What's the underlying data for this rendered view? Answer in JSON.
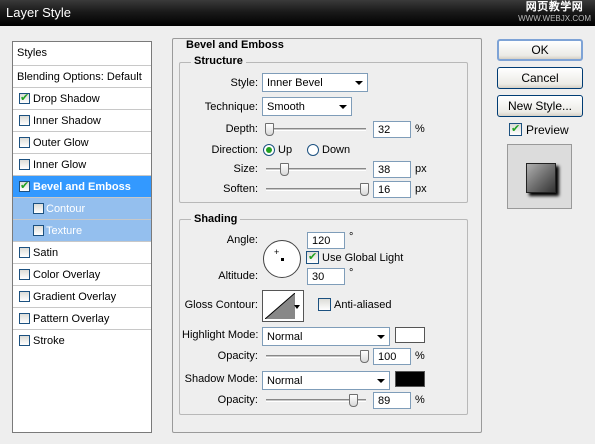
{
  "window": {
    "title": "Layer Style",
    "watermark_line1": "网页教学网",
    "watermark_line2": "WWW.WEBJX.COM"
  },
  "styles_list": {
    "header": "Styles",
    "blending": "Blending Options: Default",
    "items": [
      {
        "label": "Drop Shadow",
        "checked": true
      },
      {
        "label": "Inner Shadow",
        "checked": false
      },
      {
        "label": "Outer Glow",
        "checked": false
      },
      {
        "label": "Inner Glow",
        "checked": false
      },
      {
        "label": "Bevel and Emboss",
        "checked": true,
        "selected": true
      },
      {
        "label": "Contour",
        "checked": false,
        "sub": true
      },
      {
        "label": "Texture",
        "checked": false,
        "sub": true
      },
      {
        "label": "Satin",
        "checked": false
      },
      {
        "label": "Color Overlay",
        "checked": false
      },
      {
        "label": "Gradient Overlay",
        "checked": false
      },
      {
        "label": "Pattern Overlay",
        "checked": false
      },
      {
        "label": "Stroke",
        "checked": false
      }
    ]
  },
  "panel": {
    "title": "Bevel and Emboss",
    "structure": {
      "title": "Structure",
      "style_label": "Style:",
      "style_value": "Inner Bevel",
      "technique_label": "Technique:",
      "technique_value": "Smooth",
      "depth_label": "Depth:",
      "depth_value": "32",
      "depth_unit": "%",
      "direction_label": "Direction:",
      "direction_up": "Up",
      "direction_down": "Down",
      "size_label": "Size:",
      "size_value": "38",
      "size_unit": "px",
      "soften_label": "Soften:",
      "soften_value": "16",
      "soften_unit": "px"
    },
    "shading": {
      "title": "Shading",
      "angle_label": "Angle:",
      "angle_value": "120",
      "angle_unit": "°",
      "use_global_light": "Use Global Light",
      "altitude_label": "Altitude:",
      "altitude_value": "30",
      "altitude_unit": "°",
      "gloss_contour_label": "Gloss Contour:",
      "anti_aliased": "Anti-aliased",
      "highlight_mode_label": "Highlight Mode:",
      "highlight_mode_value": "Normal",
      "highlight_color": "#ffffff",
      "highlight_opacity_label": "Opacity:",
      "highlight_opacity_value": "100",
      "highlight_opacity_unit": "%",
      "shadow_mode_label": "Shadow Mode:",
      "shadow_mode_value": "Normal",
      "shadow_color": "#000000",
      "shadow_opacity_label": "Opacity:",
      "shadow_opacity_value": "89",
      "shadow_opacity_unit": "%"
    }
  },
  "buttons": {
    "ok": "OK",
    "cancel": "Cancel",
    "new_style": "New Style...",
    "preview": "Preview"
  },
  "slider_levels": {
    "depth": 0.03,
    "size": 0.18,
    "soften": 0.98,
    "highlight_opacity": 0.98,
    "shadow_opacity": 0.87
  }
}
